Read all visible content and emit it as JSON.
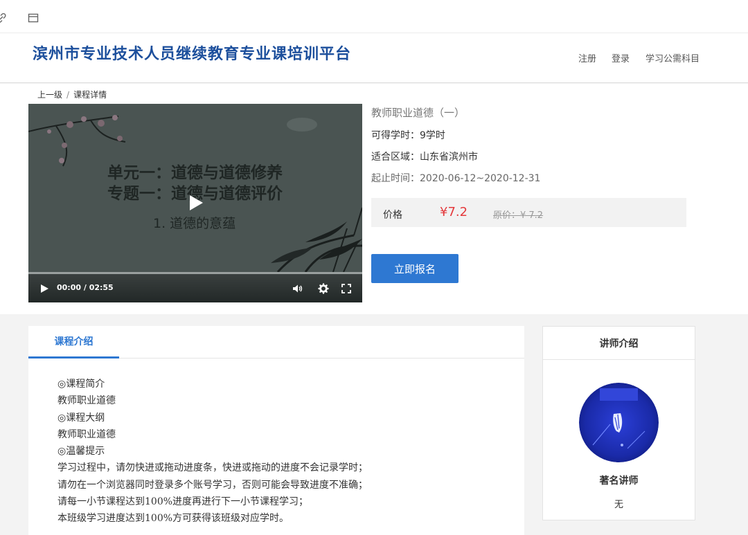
{
  "topbar": {
    "icons": [
      "link-icon",
      "window-icon"
    ]
  },
  "header": {
    "site_title": "滨州市专业技术人员继续教育专业课培训平台",
    "nav": [
      {
        "label": "注册"
      },
      {
        "label": "登录"
      },
      {
        "label": "学习公需科目"
      }
    ]
  },
  "breadcrumb": {
    "parent": "上一级",
    "separator": "/",
    "current": "课程详情"
  },
  "video": {
    "slide_line1": "单元一：道德与道德修养",
    "slide_line2": "专题一：道德与道德评价",
    "slide_line3": "1. 道德的意蕴",
    "time": "00:00 / 02:55",
    "progress": 0
  },
  "course": {
    "title": "教师职业道德（一）",
    "hours": "可得学时：9学时",
    "region": "适合区域：山东省滨州市",
    "period": "起止时间：2020-06-12~2020-12-31",
    "price_label": "价格",
    "price": "¥7.2",
    "original_price": "原价：¥ 7.2",
    "enroll_label": "立即报名"
  },
  "intro": {
    "tab_label": "课程介绍",
    "lines": [
      "◎课程简介",
      "教师职业道德",
      "◎课程大纲",
      "教师职业道德",
      "◎温馨提示",
      "学习过程中，请勿快进或拖动进度条，快进或拖动的进度不会记录学时；",
      "请勿在一个浏览器同时登录多个账号学习，否则可能会导致进度不准确；",
      "请每一小节课程达到100%进度再进行下一小节课程学习；",
      "本班级学习进度达到100%方可获得该班级对应学时。"
    ]
  },
  "teacher": {
    "header": "讲师介绍",
    "name": "著名讲师",
    "description": "无"
  },
  "colors": {
    "brand": "#1c4f9c",
    "accent": "#2e78d2",
    "price": "#e4393c"
  }
}
